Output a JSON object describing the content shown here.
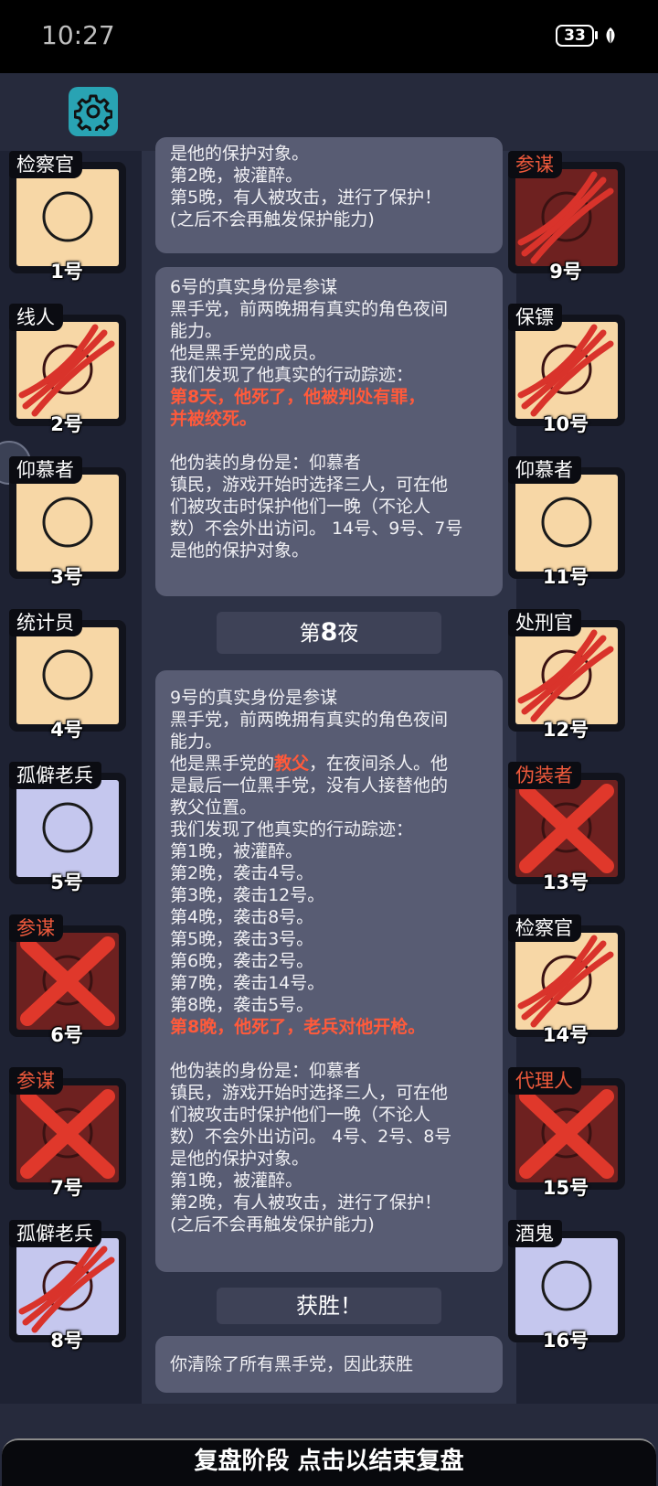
{
  "status_bar": {
    "time": "10:27",
    "battery": "33"
  },
  "icons": {
    "settings": "gear-icon",
    "battery": "battery-icon",
    "leaf": "leaf-icon"
  },
  "colors": {
    "evil": "#f05a3c",
    "red_text": "#ff5a3b",
    "settings_bg": "#29a3b3",
    "card_peach": "#f7d7a6",
    "card_lilac": "#c5c7ee",
    "card_dead": "#6e2120"
  },
  "left_players": [
    {
      "role": "检察官",
      "number": "1号",
      "state": "alive",
      "evil": false
    },
    {
      "role": "线人",
      "number": "2号",
      "state": "killed",
      "evil": false
    },
    {
      "role": "仰慕者",
      "number": "3号",
      "state": "alive",
      "evil": false
    },
    {
      "role": "统计员",
      "number": "4号",
      "state": "alive",
      "evil": false
    },
    {
      "role": "孤僻老兵",
      "number": "5号",
      "state": "alive",
      "evil": false
    },
    {
      "role": "参谋",
      "number": "6号",
      "state": "executed",
      "evil": true
    },
    {
      "role": "参谋",
      "number": "7号",
      "state": "executed",
      "evil": true
    },
    {
      "role": "孤僻老兵",
      "number": "8号",
      "state": "killed",
      "evil": false
    }
  ],
  "right_players": [
    {
      "role": "参谋",
      "number": "9号",
      "state": "killed",
      "evil": true
    },
    {
      "role": "保镖",
      "number": "10号",
      "state": "killed",
      "evil": false
    },
    {
      "role": "仰慕者",
      "number": "11号",
      "state": "alive",
      "evil": false
    },
    {
      "role": "处刑官",
      "number": "12号",
      "state": "killed",
      "evil": false
    },
    {
      "role": "伪装者",
      "number": "13号",
      "state": "executed",
      "evil": true
    },
    {
      "role": "检察官",
      "number": "14号",
      "state": "killed",
      "evil": false
    },
    {
      "role": "代理人",
      "number": "15号",
      "state": "executed",
      "evil": true
    },
    {
      "role": "酒鬼",
      "number": "16号",
      "state": "alive",
      "evil": false
    }
  ],
  "log": {
    "box1": [
      "是他的保护对象。",
      "第2晚，被灌醉。",
      "第5晚，有人被攻击，进行了保护！",
      "(之后不会再触发保护能力)"
    ],
    "box2": [
      "6号的真实身份是参谋",
      "黑手党，前两晚拥有真实的角色夜间",
      "能力。",
      "他是黑手党的成员。",
      "我们发现了他真实的行动踪迹：",
      "第8天，他死了，他被判处有罪，",
      "并被绞死。",
      "",
      "他伪装的身份是：仰慕者",
      "镇民，游戏开始时选择三人，可在他",
      "们被攻击时保护他们一晚（不论人",
      "数）不会外出访问。 14号、9号、7号",
      "是他的保护对象。"
    ],
    "night_prefix": "第",
    "night_number": "8",
    "night_suffix": "夜",
    "box3_before": [
      "9号的真实身份是参谋",
      "黑手党，前两晚拥有真实的角色夜间",
      "能力。"
    ],
    "box3_godfather_prefix": "他是黑手党的",
    "box3_godfather_word": "教父",
    "box3_godfather_suffix": "，在夜间杀人。他",
    "box3_after": [
      "是最后一位黑手党，没有人接替他的",
      "教父位置。",
      "我们发现了他真实的行动踪迹：",
      "第1晚，被灌醉。",
      "第2晚，袭击4号。",
      "第3晚，袭击12号。",
      "第4晚，袭击8号。",
      "第5晚，袭击3号。",
      "第6晚，袭击2号。",
      "第7晚，袭击14号。",
      "第8晚，袭击5号。"
    ],
    "box3_death": "第8晚，他死了，老兵对他开枪。",
    "box3_tail": [
      "",
      "他伪装的身份是：仰慕者",
      "镇民，游戏开始时选择三人，可在他",
      "们被攻击时保护他们一晚（不论人",
      "数）不会外出访问。 4号、2号、8号",
      "是他的保护对象。",
      "第1晚，被灌醉。",
      "第2晚，有人被攻击，进行了保护！",
      "(之后不会再触发保护能力)"
    ],
    "victory_header": "获胜！",
    "victory_text": "你清除了所有黑手党，因此获胜"
  },
  "bottom_bar": {
    "label": "复盘阶段 点击以结束复盘"
  }
}
